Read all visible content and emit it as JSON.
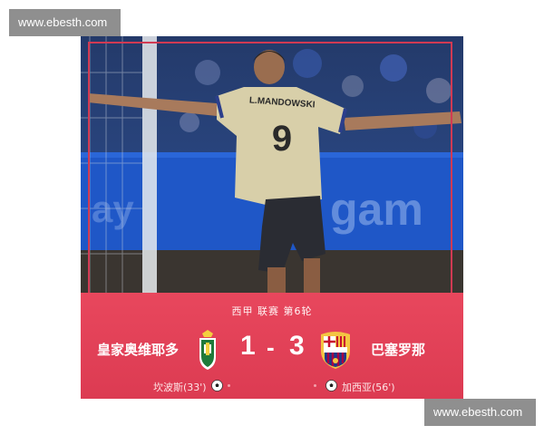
{
  "watermark": {
    "top": "www.ebesth.com",
    "bottom": "www.ebesth.com"
  },
  "photo": {
    "jersey_name": "L.MANDOWSKI",
    "jersey_number": "9",
    "stand_board": "gam"
  },
  "match": {
    "league": "西甲 联赛 第6轮",
    "home": {
      "name": "皇家奥维耶多",
      "score": "1",
      "scorer": "坎波斯(33')",
      "crest": "real-oviedo-crest-icon"
    },
    "separator": "-",
    "away": {
      "name": "巴塞罗那",
      "score": "3",
      "scorer": "加西亚(56')",
      "crest": "fc-barcelona-crest-icon"
    }
  },
  "colors": {
    "scoreboard": "#e2425a",
    "frame": "#d13a53",
    "jersey": "#d8cfa9",
    "stand": "#1f57c7"
  }
}
